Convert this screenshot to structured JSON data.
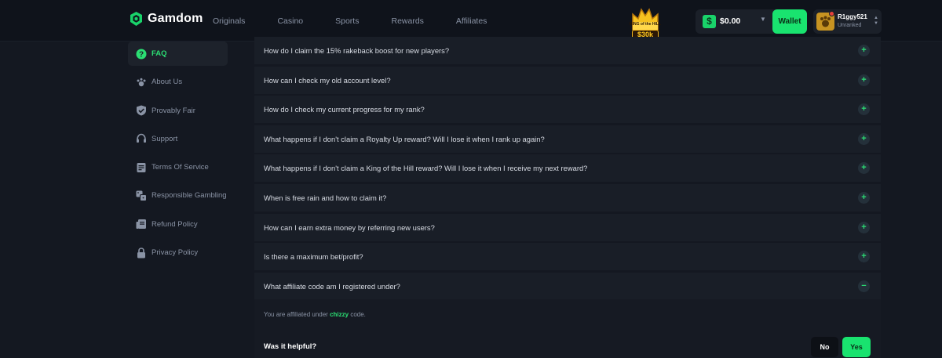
{
  "header": {
    "brand": "Gamdom",
    "nav": [
      "Originals",
      "Casino",
      "Sports",
      "Rewards",
      "Affiliates"
    ],
    "promo": {
      "label": "KING of the HILL",
      "prize": "$30k"
    },
    "wallet": {
      "balance": "$0.00",
      "button_label": "Wallet"
    },
    "user": {
      "name": "R1ggy521",
      "rank": "Unranked"
    }
  },
  "sidebar": {
    "items": [
      {
        "label": "FAQ",
        "icon": "question-circle-icon",
        "active": true
      },
      {
        "label": "About Us",
        "icon": "paw-icon"
      },
      {
        "label": "Provably Fair",
        "icon": "shield-check-icon"
      },
      {
        "label": "Support",
        "icon": "headset-icon"
      },
      {
        "label": "Terms Of Service",
        "icon": "document-icon"
      },
      {
        "label": "Responsible Gambling",
        "icon": "dice-icon"
      },
      {
        "label": "Refund Policy",
        "icon": "receipt-icon"
      },
      {
        "label": "Privacy Policy",
        "icon": "lock-icon"
      }
    ]
  },
  "faq": {
    "questions": [
      "How do I claim the 15% rakeback boost for new players?",
      "How can I check my old account level?",
      "How do I check my current progress for my rank?",
      "What happens if I don't claim a Royalty Up reward? Will I lose it when I rank up again?",
      "What happens if I don't claim a King of the Hill reward? Will I lose it when I receive my next reward?",
      "When is free rain and how to claim it?",
      "How can I earn extra money by referring new users?",
      "Is there a maximum bet/profit?",
      "What affiliate code am I registered under?"
    ],
    "expand_symbol": "+",
    "collapse_symbol": "−",
    "answer": {
      "prefix": "You are affiliated under",
      "code": "chizzy",
      "suffix": "code."
    },
    "helpful": {
      "label": "Was it helpful?",
      "no": "No",
      "yes": "Yes"
    }
  },
  "colors": {
    "accent": "#19e36f",
    "background": "#141821",
    "panel": "#191e27"
  }
}
